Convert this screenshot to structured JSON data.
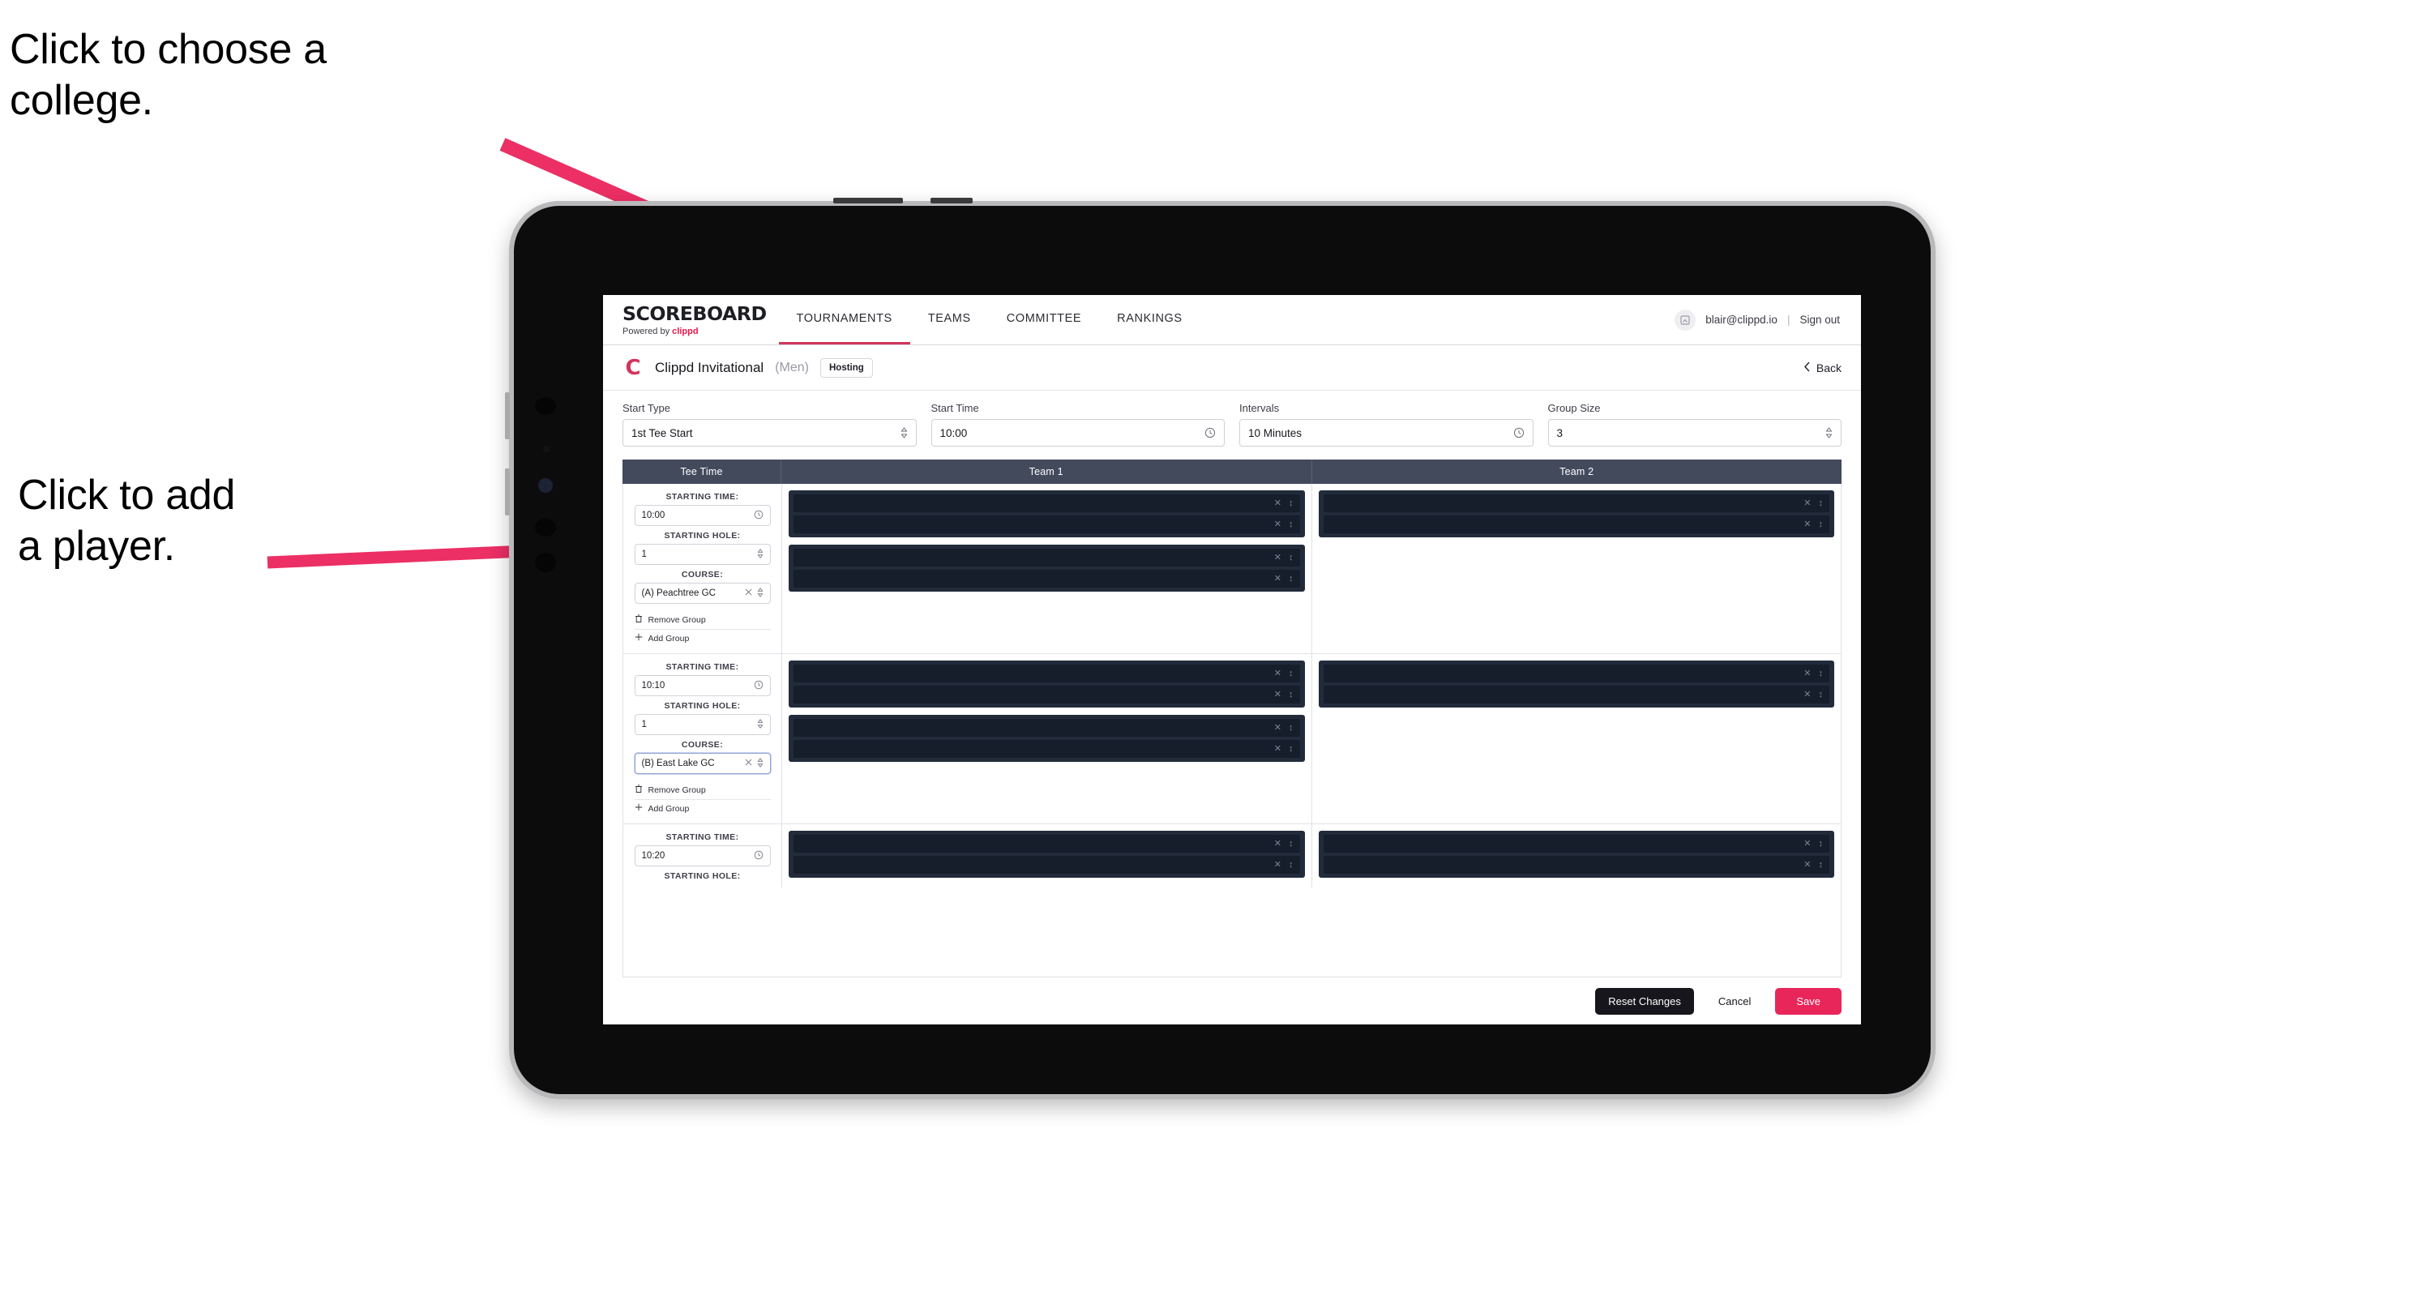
{
  "annotations": {
    "choose_college": "Click to choose a\ncollege.",
    "add_player": "Click to add\na player."
  },
  "colors": {
    "accent_pink": "#e8265a",
    "arrow_pink": "#ec2f64",
    "nav_active": "#d1355c",
    "table_header_bg": "#424a5c",
    "panel_dark": "#222b3a",
    "slot_dark": "#161d2b"
  },
  "navbar": {
    "brand_word": "SCOREBOARD",
    "brand_sub_prefix": "Powered by",
    "brand_sub_name": "clippd",
    "tabs": [
      {
        "label": "TOURNAMENTS",
        "active": true
      },
      {
        "label": "TEAMS",
        "active": false
      },
      {
        "label": "COMMITTEE",
        "active": false
      },
      {
        "label": "RANKINGS",
        "active": false
      }
    ],
    "avatar_icon": "user-avatar-icon",
    "user_email": "blair@clippd.io",
    "separator": "|",
    "sign_out": "Sign out"
  },
  "tournament_bar": {
    "logo_letter": "C",
    "name": "Clippd Invitational",
    "gender": "(Men)",
    "badge": "Hosting",
    "back_label": "Back",
    "back_icon": "chevron-left-icon"
  },
  "settings": {
    "fields": [
      {
        "label": "Start Type",
        "value": "1st Tee Start",
        "icon": "stepper-icon"
      },
      {
        "label": "Start Time",
        "value": "10:00",
        "icon": "clock-icon"
      },
      {
        "label": "Intervals",
        "value": "10 Minutes",
        "icon": "clock-icon"
      },
      {
        "label": "Group Size",
        "value": "3",
        "icon": "stepper-icon"
      }
    ]
  },
  "table": {
    "headers": {
      "tee_time": "Tee Time",
      "team1": "Team 1",
      "team2": "Team 2"
    },
    "labels": {
      "starting_time": "STARTING TIME:",
      "starting_hole": "STARTING HOLE:",
      "course": "COURSE:",
      "remove_group": "Remove Group",
      "add_group": "Add Group",
      "remove_icon": "trash-icon",
      "add_icon": "plus-icon",
      "clock_icon": "clock-icon",
      "stepper_icon": "stepper-icon",
      "clear_icon": "close-x-icon"
    },
    "groups": [
      {
        "starting_time": "10:00",
        "starting_hole": "1",
        "course": "(A) Peachtree GC",
        "course_focused": false,
        "team1_panels": [
          {
            "slots": [
              {
                "name": ""
              },
              {
                "name": ""
              }
            ]
          },
          {
            "slots": [
              {
                "name": ""
              },
              {
                "name": ""
              }
            ]
          }
        ],
        "team2_panels": [
          {
            "slots": [
              {
                "name": ""
              },
              {
                "name": ""
              }
            ]
          }
        ]
      },
      {
        "starting_time": "10:10",
        "starting_hole": "1",
        "course": "(B) East Lake GC",
        "course_focused": true,
        "team1_panels": [
          {
            "slots": [
              {
                "name": ""
              },
              {
                "name": ""
              }
            ]
          },
          {
            "slots": [
              {
                "name": ""
              },
              {
                "name": ""
              }
            ]
          }
        ],
        "team2_panels": [
          {
            "slots": [
              {
                "name": ""
              },
              {
                "name": ""
              }
            ]
          }
        ]
      },
      {
        "starting_time": "10:20",
        "starting_hole": "",
        "course": "",
        "course_focused": false,
        "partial": true,
        "team1_panels": [
          {
            "slots": [
              {
                "name": ""
              },
              {
                "name": ""
              }
            ]
          }
        ],
        "team2_panels": [
          {
            "slots": [
              {
                "name": ""
              },
              {
                "name": ""
              }
            ]
          }
        ]
      }
    ]
  },
  "footer": {
    "reset": "Reset Changes",
    "cancel": "Cancel",
    "save": "Save"
  }
}
